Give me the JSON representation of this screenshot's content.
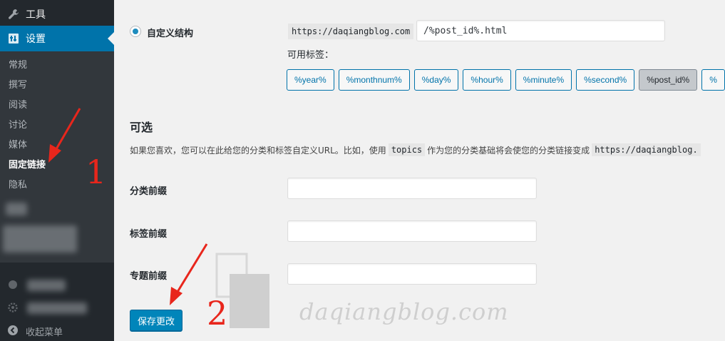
{
  "sidebar": {
    "tools_label": "工具",
    "settings_label": "设置",
    "submenu": [
      "常规",
      "撰写",
      "阅读",
      "讨论",
      "媒体",
      "固定链接",
      "隐私"
    ],
    "current_index": 5,
    "collapse_label": "收起菜单",
    "icons": [
      "wrench-icon",
      "settings-icon",
      "collapse-arrow-icon"
    ]
  },
  "permalink": {
    "custom_label": "自定义结构",
    "base_url": "https://daqiangblog.com",
    "structure_value": "/%post_id%.html",
    "available_tags_label": "可用标签：",
    "tags": [
      "%year%",
      "%monthnum%",
      "%day%",
      "%hour%",
      "%minute%",
      "%second%",
      "%post_id%",
      "%"
    ],
    "active_tag_index": 6
  },
  "optional": {
    "heading": "可选",
    "desc_part1": "如果您喜欢，您可以在此给您的分类和标签自定义URL。比如，使用",
    "desc_code1": "topics",
    "desc_part2": "作为您的分类基础将会使您的分类链接变成",
    "desc_code2": "https://daqiangblog.",
    "category_base_label": "分类前缀",
    "tag_base_label": "标签前缀",
    "topic_base_label": "专题前缀",
    "category_base_value": "",
    "tag_base_value": "",
    "topic_base_value": ""
  },
  "save_label": "保存更改",
  "annotations": {
    "one": "1",
    "two": "2",
    "color": "#e8261c"
  },
  "watermark": {
    "text": "daqiangblog.com"
  },
  "colors": {
    "sidebar_bg": "#23282d",
    "submenu_bg": "#32373c",
    "accent": "#0073aa",
    "button": "#0085ba"
  }
}
